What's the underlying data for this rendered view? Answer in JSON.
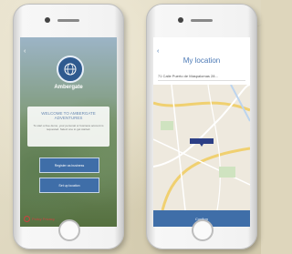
{
  "left_screen": {
    "status_left": "",
    "status_time": "",
    "status_right": "",
    "back": "‹",
    "logo_icon": "globe-icon",
    "logo_text": "Ambergate",
    "welcome_title": "WELCOME TO AMBERGATE ADVENTURES",
    "welcome_body": "To start a free demo, your personal or business account is requested. Select one to get started.",
    "button_primary": "Register as business",
    "button_secondary": "Set up location",
    "privacy_label": "Policy Privacy"
  },
  "right_screen": {
    "status_left": "",
    "status_time": "",
    "status_right": "",
    "back": "‹",
    "title": "My location",
    "address": "71 Calle Puerto de Maspalomas 28...",
    "pin_label": "",
    "confirm_label": "Confirm"
  }
}
